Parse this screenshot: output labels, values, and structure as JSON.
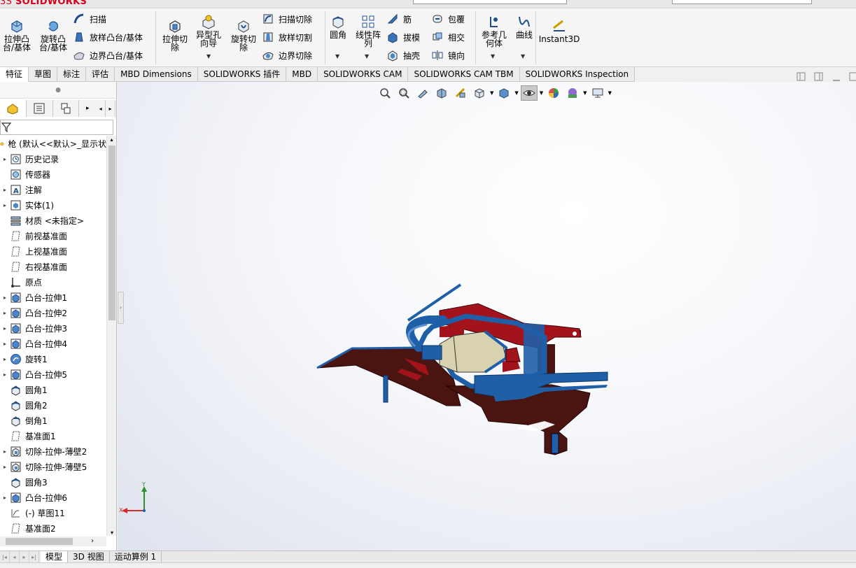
{
  "app": {
    "logo_brand": "SOLIDWORKS",
    "brand_color": "#d6001c"
  },
  "ribbon": {
    "extrude_boss": "拉伸凸台/基体",
    "revolve_boss": "旋转凸台/基体",
    "sweep": "扫描",
    "loft_boss": "放样凸台/基体",
    "boundary_boss": "边界凸台/基体",
    "extrude_cut": "拉伸切除",
    "hole_wizard": "异型孔向导",
    "revolve_cut": "旋转切除",
    "sweep_cut": "扫描切除",
    "loft_cut": "放样切割",
    "boundary_cut": "边界切除",
    "fillet": "圆角",
    "linear_pattern": "线性阵列",
    "rib": "筋",
    "draft": "拔模",
    "shell": "抽壳",
    "wrap": "包覆",
    "intersect": "相交",
    "mirror": "镜向",
    "ref_geometry": "参考几何体",
    "curves": "曲线",
    "instant3d": "Instant3D"
  },
  "tabs": [
    {
      "label": "特征"
    },
    {
      "label": "草图"
    },
    {
      "label": "标注"
    },
    {
      "label": "评估"
    },
    {
      "label": "MBD Dimensions"
    },
    {
      "label": "SOLIDWORKS 插件"
    },
    {
      "label": "MBD"
    },
    {
      "label": "SOLIDWORKS CAM"
    },
    {
      "label": "SOLIDWORKS CAM TBM"
    },
    {
      "label": "SOLIDWORKS Inspection"
    }
  ],
  "tree": {
    "root": "枪 (默认<<默认>_显示状",
    "items": [
      {
        "label": "历史记录",
        "icon": "history-icon",
        "expand": true
      },
      {
        "label": "传感器",
        "icon": "sensor-icon",
        "expand": false
      },
      {
        "label": "注解",
        "icon": "annotation-icon",
        "expand": true
      },
      {
        "label": "实体(1)",
        "icon": "solid-body-icon",
        "expand": true
      },
      {
        "label": "材质 <未指定>",
        "icon": "material-icon",
        "expand": false
      },
      {
        "label": "前视基准面",
        "icon": "plane-icon",
        "expand": false
      },
      {
        "label": "上视基准面",
        "icon": "plane-icon",
        "expand": false
      },
      {
        "label": "右视基准面",
        "icon": "plane-icon",
        "expand": false
      },
      {
        "label": "原点",
        "icon": "origin-icon",
        "expand": false
      },
      {
        "label": "凸台-拉伸1",
        "icon": "extrude-icon",
        "expand": true
      },
      {
        "label": "凸台-拉伸2",
        "icon": "extrude-icon",
        "expand": true
      },
      {
        "label": "凸台-拉伸3",
        "icon": "extrude-icon",
        "expand": true
      },
      {
        "label": "凸台-拉伸4",
        "icon": "extrude-icon",
        "expand": true
      },
      {
        "label": "旋转1",
        "icon": "revolve-icon",
        "expand": true
      },
      {
        "label": "凸台-拉伸5",
        "icon": "extrude-icon",
        "expand": true
      },
      {
        "label": "圆角1",
        "icon": "fillet-icon",
        "expand": false
      },
      {
        "label": "圆角2",
        "icon": "fillet-icon",
        "expand": false
      },
      {
        "label": "倒角1",
        "icon": "chamfer-icon",
        "expand": false
      },
      {
        "label": "基准面1",
        "icon": "plane-icon",
        "expand": false
      },
      {
        "label": "切除-拉伸-薄壁2",
        "icon": "cut-extrude-icon",
        "expand": true
      },
      {
        "label": "切除-拉伸-薄壁5",
        "icon": "cut-extrude-icon",
        "expand": true
      },
      {
        "label": "圆角3",
        "icon": "fillet-icon",
        "expand": false
      },
      {
        "label": "凸台-拉伸6",
        "icon": "extrude-icon",
        "expand": true
      },
      {
        "label": "(-) 草图11",
        "icon": "sketch-icon",
        "expand": false
      },
      {
        "label": "基准面2",
        "icon": "plane-icon",
        "expand": false
      }
    ]
  },
  "bottom_tabs": [
    {
      "label": "模型"
    },
    {
      "label": "3D 视图"
    },
    {
      "label": "运动算例 1"
    }
  ],
  "triad": {
    "x": "X",
    "y": "Y"
  },
  "colors": {
    "model_blue": "#1f5fa8",
    "model_red": "#a3131c",
    "model_dark": "#4a1510",
    "model_beige": "#d8d2b0"
  }
}
